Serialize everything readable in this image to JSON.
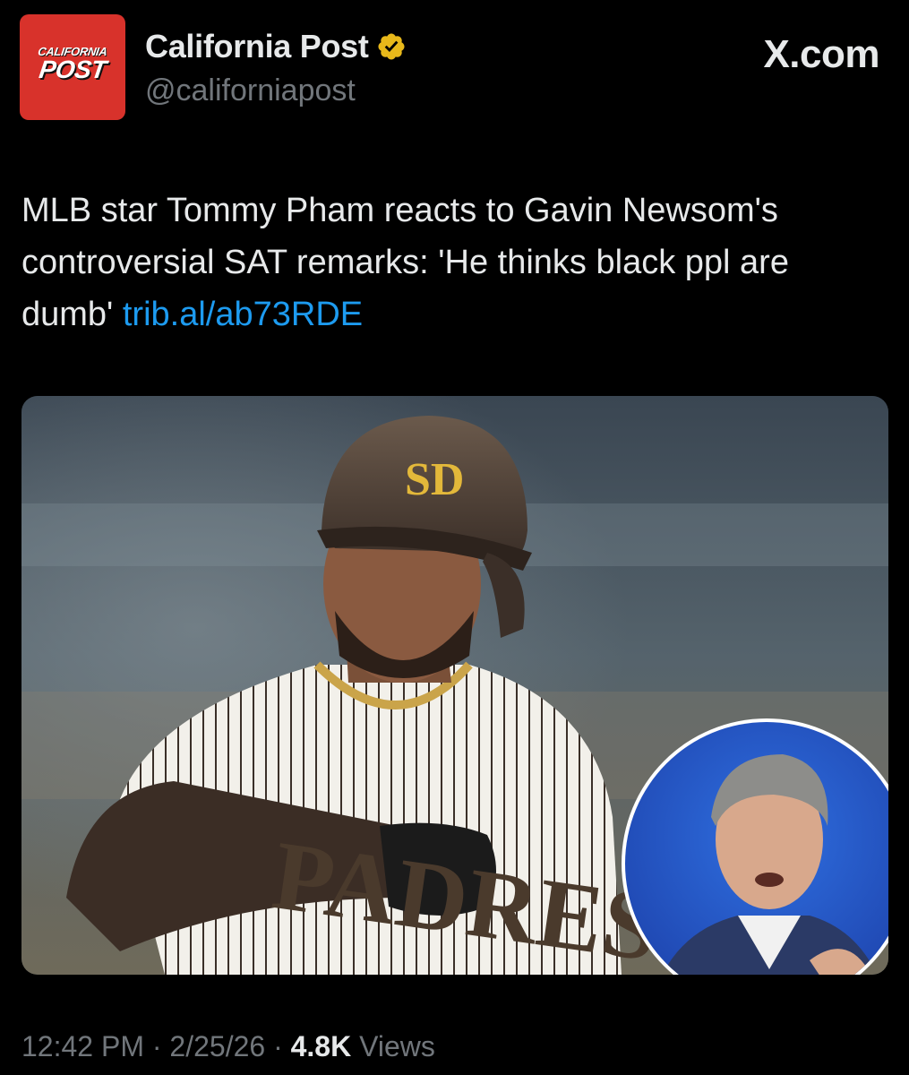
{
  "account": {
    "logo_text_top": "CALIFORNIA",
    "logo_text_bottom": "POST",
    "display_name": "California Post",
    "verified_icon": "verified-badge-gold",
    "handle": "@californiapost",
    "logo_color": "#d8322b",
    "badge_color": "#e8b81a"
  },
  "source": {
    "label": "X.com"
  },
  "tweet": {
    "text": "MLB star Tommy Pham reacts to Gavin Newsom's controversial SAT remarks: 'He thinks black ppl are dumb' ",
    "link": "trib.al/ab73RDE",
    "link_color": "#1d9bf0"
  },
  "media": {
    "jersey_text": "PADRES",
    "helmet_logo": "SD"
  },
  "footer": {
    "time": "12:42 PM",
    "separator": "·",
    "date": "2/25/26",
    "views_count": "4.8K",
    "views_label": "Views"
  }
}
